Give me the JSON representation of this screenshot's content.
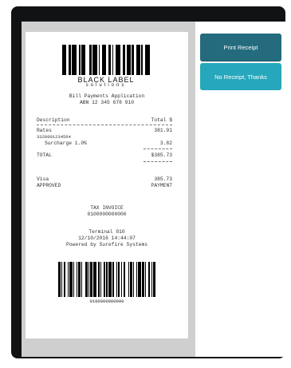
{
  "brand": {
    "name": "BLACK LABEL",
    "sub": "solutions"
  },
  "app": {
    "title": "Bill Payments Application",
    "abn": "ABN 12 345 678 910"
  },
  "receipt": {
    "header_desc": "Description",
    "header_total": "Total $",
    "item_name": "Rates",
    "item_amount": "381.91",
    "account": "3320001234564",
    "surcharge_label": "Surcharge 1.0%",
    "surcharge_amount": "3.82",
    "total_label": "TOTAL",
    "total_amount": "$385.73",
    "pay_method": "Visa",
    "pay_status": "APPROVED",
    "pay_amount": "385.73",
    "pay_label": "PAYMENT",
    "tax_invoice": "TAX INVOICE",
    "invoice_number": "0100000000000",
    "terminal": "Terminal 010",
    "datetime": "12/10/2016 14:44:07",
    "powered_by": "Powered by Surefire Systems",
    "barcode_number": "0100000000000"
  },
  "actions": {
    "print": "Print Receipt",
    "no_receipt": "No Receipt, Thanks"
  },
  "colors": {
    "print_button": "#236b7d",
    "no_receipt_button": "#27a7bb",
    "bezel": "#101214"
  },
  "icons": {
    "logo": "barcode-logo-icon",
    "barcode": "barcode-icon"
  }
}
